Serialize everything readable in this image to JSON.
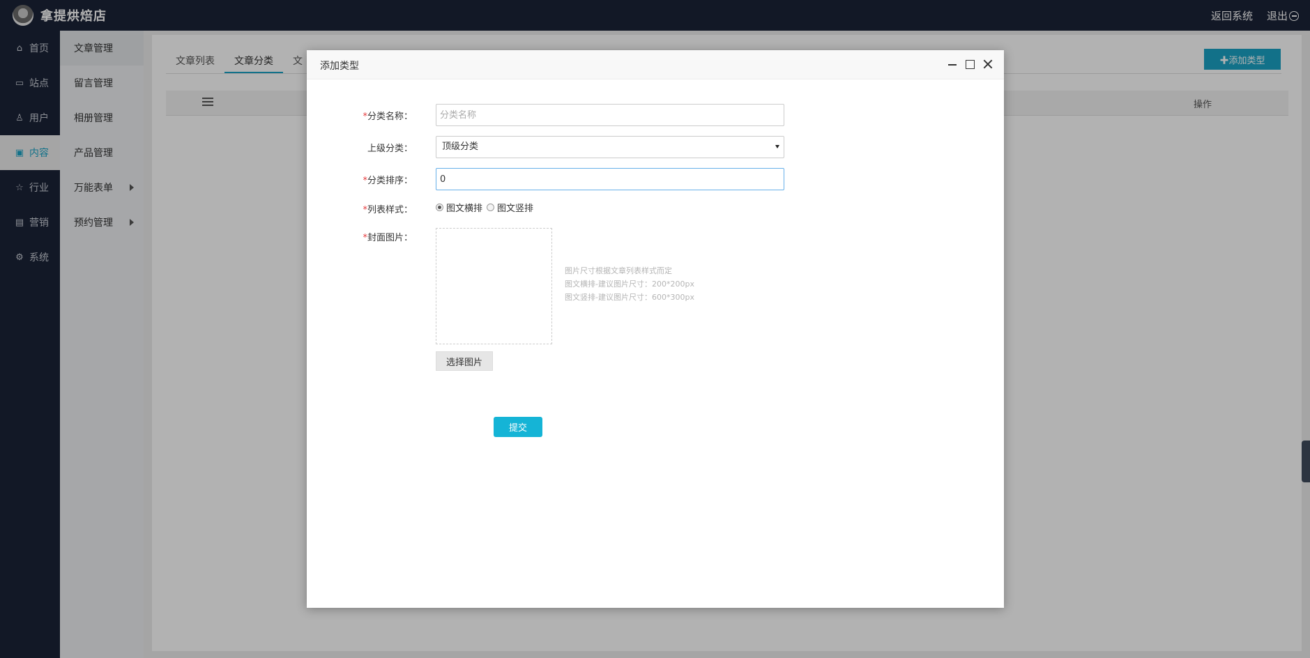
{
  "topbar": {
    "brand_name": "拿提烘焙店",
    "back_label": "返回系统",
    "logout_label": "退出"
  },
  "sidebar": {
    "items": [
      {
        "label": "首页",
        "icon": "home-icon"
      },
      {
        "label": "站点",
        "icon": "monitor-icon"
      },
      {
        "label": "用户",
        "icon": "user-icon"
      },
      {
        "label": "内容",
        "icon": "inbox-icon",
        "active": true
      },
      {
        "label": "行业",
        "icon": "star-icon"
      },
      {
        "label": "营销",
        "icon": "marketing-icon"
      },
      {
        "label": "系统",
        "icon": "gear-icon"
      }
    ]
  },
  "subsidebar": {
    "items": [
      {
        "label": "文章管理",
        "active": true
      },
      {
        "label": "留言管理"
      },
      {
        "label": "相册管理"
      },
      {
        "label": "产品管理"
      },
      {
        "label": "万能表单",
        "has_arrow": true
      },
      {
        "label": "预约管理",
        "has_arrow": true
      }
    ]
  },
  "main": {
    "tabs": [
      {
        "label": "文章列表"
      },
      {
        "label": "文章分类",
        "active": true
      },
      {
        "label": "文"
      }
    ],
    "add_type_label": "✚添加类型",
    "table_ops_label": "操作"
  },
  "modal": {
    "title": "添加类型",
    "required_mark": "*",
    "fields": {
      "name_label": "分类名称：",
      "name_placeholder": "分类名称",
      "parent_label": "上级分类：",
      "parent_value": "顶级分类",
      "sort_label": "分类排序：",
      "sort_value": "0",
      "style_label": "列表样式：",
      "style_option_1": "图文横排",
      "style_option_2": "图文竖排",
      "style_selected": "图文横排",
      "cover_label": "封面图片："
    },
    "cover_hints": [
      "图片尺寸根据文章列表样式而定",
      "图文横排-建议图片尺寸：200*200px",
      "图文竖排-建议图片尺寸：600*300px"
    ],
    "choose_image_label": "选择图片",
    "submit_label": "提交"
  },
  "colors": {
    "topbar_bg": "#1b2337",
    "accent": "#1aa3c4",
    "submit": "#15b4d6",
    "required": "#e4393c"
  }
}
